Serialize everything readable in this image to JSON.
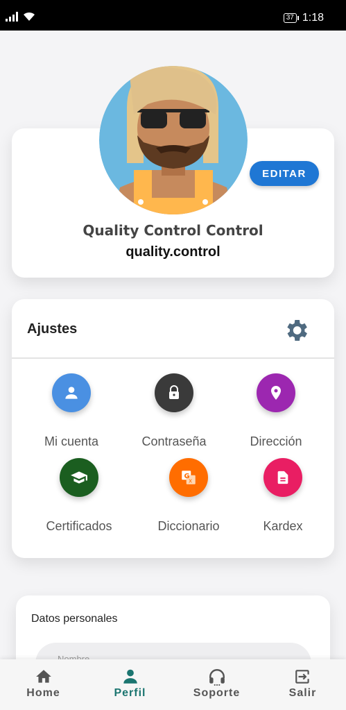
{
  "status_bar": {
    "battery": "37",
    "time": "1:18"
  },
  "profile": {
    "edit_label": "EDITAR",
    "full_name": "Quality Control Control",
    "username": "quality.control"
  },
  "settings": {
    "title": "Ajustes",
    "items": [
      {
        "label": "Mi cuenta",
        "icon": "person-icon",
        "color": "#4a90e2"
      },
      {
        "label": "Contraseña",
        "icon": "lock-icon",
        "color": "#3a3a3a"
      },
      {
        "label": "Dirección",
        "icon": "location-pin-icon",
        "color": "#9c27b0"
      },
      {
        "label": "Certificados",
        "icon": "graduation-cap-icon",
        "color": "#1b5e20"
      },
      {
        "label": "Diccionario",
        "icon": "translate-icon",
        "color": "#ff6d00"
      },
      {
        "label": "Kardex",
        "icon": "document-icon",
        "color": "#e91e63"
      }
    ]
  },
  "personal": {
    "title": "Datos personales",
    "name_placeholder": "Nombre"
  },
  "bottom_nav": {
    "items": [
      {
        "label": "Home",
        "icon": "home-icon"
      },
      {
        "label": "Perfil",
        "icon": "person-icon",
        "active": true,
        "active_color": "#1b7570"
      },
      {
        "label": "Soporte",
        "icon": "headset-icon"
      },
      {
        "label": "Salir",
        "icon": "exit-icon"
      }
    ]
  }
}
